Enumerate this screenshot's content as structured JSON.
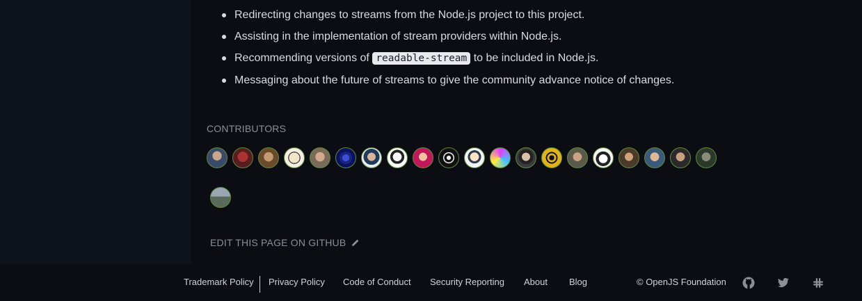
{
  "content": {
    "bullets": {
      "item1": "Redirecting changes to streams from the Node.js project to this project.",
      "item2": "Assisting in the implementation of stream providers within Node.js.",
      "item3_before": "Recommending versions of ",
      "item3_code": "readable-stream",
      "item3_after": " to be included in Node.js.",
      "item4": "Messaging about the future of streams to give the community advance notice of changes."
    },
    "contributors_heading": "CONTRIBUTORS",
    "contributor_count": 21,
    "edit_link": "EDIT THIS PAGE ON GITHUB",
    "edit_icon": "pencil-icon"
  },
  "footer": {
    "links": {
      "trademark": "Trademark Policy",
      "privacy": "Privacy Policy",
      "conduct": "Code of Conduct",
      "security": "Security Reporting",
      "about": "About",
      "blog": "Blog"
    },
    "copyright": "© OpenJS Foundation",
    "icons": [
      "github-icon",
      "twitter-icon",
      "slack-icon"
    ]
  },
  "colors": {
    "background": "#0b0d12",
    "sidebar": "#0e121a",
    "text": "#d8dbe0",
    "muted": "#8a8f98",
    "avatar_border": "#5f8b3a"
  }
}
